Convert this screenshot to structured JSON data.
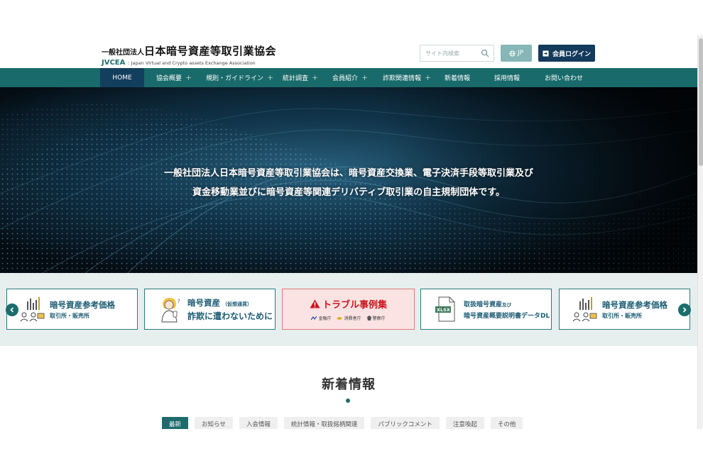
{
  "header": {
    "logo_small": "一般社団法人",
    "logo_big": "日本暗号資産等取引業協会",
    "logo_abbr": "JVCEA",
    "logo_full": ": Japan Virtual and Crypto assets Exchange Association",
    "search_placeholder": "サイト内検索",
    "lang_label": "JP",
    "login_label": "会員ログイン"
  },
  "nav": {
    "items": [
      {
        "label": "HOME",
        "plus": ""
      },
      {
        "label": "協会概要",
        "plus": "+"
      },
      {
        "label": "規則・ガイドライン",
        "plus": "+"
      },
      {
        "label": "統計調査",
        "plus": "+"
      },
      {
        "label": "会員紹介",
        "plus": "+"
      },
      {
        "label": "詐欺関連情報",
        "plus": "+"
      },
      {
        "label": "新着情報",
        "plus": ""
      },
      {
        "label": "採用情報",
        "plus": ""
      },
      {
        "label": "お問い合わせ",
        "plus": ""
      }
    ]
  },
  "hero": {
    "line1": "一般社団法人日本暗号資産等取引業協会は、暗号資産交換業、電子決済手段等取引業及び",
    "line2": "資金移動業並びに暗号資産等関連デリバティブ取引業の自主規制団体です。"
  },
  "banners": {
    "card1": {
      "title": "暗号資産参考価格",
      "sub": "取引所・販売所"
    },
    "card2": {
      "title": "暗号資産",
      "title_small": "（仮想通貨）",
      "sub": "詐欺に遭わないために"
    },
    "card3": {
      "title": "トラブル事例集",
      "agency1": "金融庁",
      "agency2": "消費者庁",
      "agency3": "警察庁"
    },
    "card4": {
      "line1": "取扱暗号資産",
      "line1_small": "及び",
      "line2": "暗号資産概要説明書データDL",
      "icon_text": "XLSX"
    },
    "card5": {
      "title": "暗号資産参考価格",
      "sub": "取引所・販売所"
    }
  },
  "news": {
    "title": "新着情報",
    "tabs": [
      "最新",
      "お知らせ",
      "入会情報",
      "統計情報・取扱銘柄関連",
      "パブリックコメント",
      "注意喚起",
      "その他"
    ],
    "active_tab": "最新"
  },
  "colors": {
    "nav_bg": "#196a6b",
    "home_bg": "#133f5e",
    "login_bg": "#143a5c",
    "lang_bg": "#86b6b6",
    "accent_text": "#1d5c74",
    "trouble_red": "#c8161d"
  }
}
